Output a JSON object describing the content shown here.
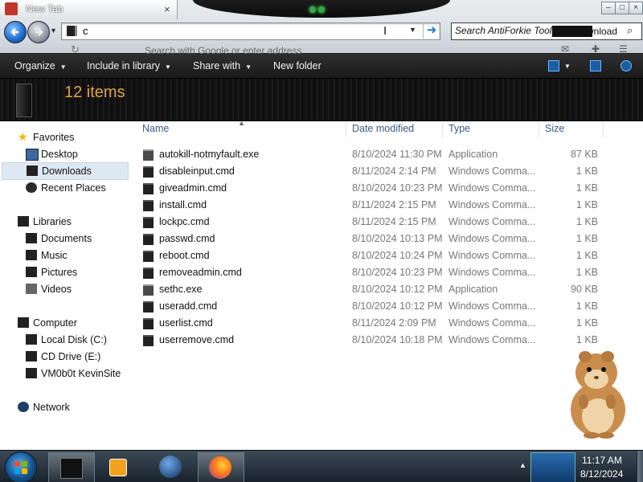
{
  "browser": {
    "tab_label": "New Tab",
    "tab_close": "×",
    "address_value": "c",
    "search_placeholder": "Search with Google or enter address",
    "search_box_text": "Search AntiForkie Tools",
    "search_box_extra": "wnload",
    "window_buttons": [
      "–",
      "□",
      "×"
    ]
  },
  "toolbar": {
    "organize": "Organize",
    "include_in_library": "Include in library",
    "share_with": "Share with",
    "new_folder": "New folder"
  },
  "details": {
    "items_count": "12 items"
  },
  "nav": {
    "favorites": "Favorites",
    "desktop": "Desktop",
    "downloads": "Downloads",
    "recent_places": "Recent Places",
    "libraries": "Libraries",
    "documents": "Documents",
    "music": "Music",
    "pictures": "Pictures",
    "videos": "Videos",
    "computer": "Computer",
    "local_disk": "Local Disk (C:)",
    "cd_drive": "CD Drive (E:)",
    "vm_share": "VM0b0t KevinSite",
    "network": "Network"
  },
  "columns": {
    "name": "Name",
    "date_modified": "Date modified",
    "type": "Type",
    "size": "Size"
  },
  "files": [
    {
      "name": "autokill-notmyfault.exe",
      "date": "8/10/2024 11:30 PM",
      "type": "Application",
      "size": "87 KB",
      "kind": "exe"
    },
    {
      "name": "disableinput.cmd",
      "date": "8/11/2024 2:14 PM",
      "type": "Windows Comma...",
      "size": "1 KB",
      "kind": "cmd"
    },
    {
      "name": "giveadmin.cmd",
      "date": "8/10/2024 10:23 PM",
      "type": "Windows Comma...",
      "size": "1 KB",
      "kind": "cmd"
    },
    {
      "name": "install.cmd",
      "date": "8/11/2024 2:15 PM",
      "type": "Windows Comma...",
      "size": "1 KB",
      "kind": "cmd"
    },
    {
      "name": "lockpc.cmd",
      "date": "8/11/2024 2:15 PM",
      "type": "Windows Comma...",
      "size": "1 KB",
      "kind": "cmd"
    },
    {
      "name": "passwd.cmd",
      "date": "8/10/2024 10:13 PM",
      "type": "Windows Comma...",
      "size": "1 KB",
      "kind": "cmd"
    },
    {
      "name": "reboot.cmd",
      "date": "8/10/2024 10:24 PM",
      "type": "Windows Comma...",
      "size": "1 KB",
      "kind": "cmd"
    },
    {
      "name": "removeadmin.cmd",
      "date": "8/10/2024 10:23 PM",
      "type": "Windows Comma...",
      "size": "1 KB",
      "kind": "cmd"
    },
    {
      "name": "sethc.exe",
      "date": "8/10/2024 10:12 PM",
      "type": "Application",
      "size": "90 KB",
      "kind": "exe"
    },
    {
      "name": "useradd.cmd",
      "date": "8/10/2024 10:12 PM",
      "type": "Windows Comma...",
      "size": "1 KB",
      "kind": "cmd"
    },
    {
      "name": "userlist.cmd",
      "date": "8/11/2024 2:09 PM",
      "type": "Windows Comma...",
      "size": "1 KB",
      "kind": "cmd"
    },
    {
      "name": "userremove.cmd",
      "date": "8/10/2024 10:18 PM",
      "type": "Windows Comma...",
      "size": "1 KB",
      "kind": "cmd"
    }
  ],
  "taskbar": {
    "time": "11:17 AM",
    "date": "8/12/2024"
  },
  "colors": {
    "accent_orange": "#e0a24a",
    "header_dark": "#1a1a1a",
    "link_blue": "#3a5a80"
  }
}
